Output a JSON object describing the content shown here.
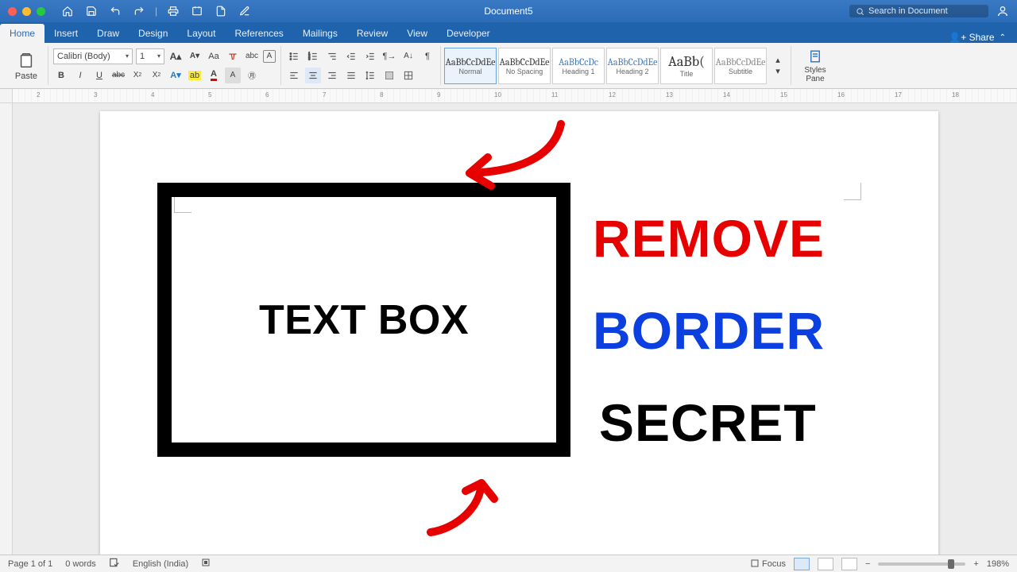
{
  "titlebar": {
    "document_name": "Document5",
    "search_placeholder": "Search in Document"
  },
  "tabs": {
    "items": [
      "Home",
      "Insert",
      "Draw",
      "Design",
      "Layout",
      "References",
      "Mailings",
      "Review",
      "View",
      "Developer"
    ],
    "active": "Home",
    "share": "Share"
  },
  "ribbon": {
    "paste": "Paste",
    "font_name": "Calibri (Body)",
    "font_size": "1",
    "bold": "B",
    "italic": "I",
    "underline": "U",
    "strike": "abc",
    "sub": "X",
    "sup": "X",
    "styles": [
      {
        "preview": "AaBbCcDdEe",
        "name": "Normal",
        "blue": false,
        "selected": true
      },
      {
        "preview": "AaBbCcDdEe",
        "name": "No Spacing",
        "blue": false,
        "selected": false
      },
      {
        "preview": "AaBbCcDc",
        "name": "Heading 1",
        "blue": true,
        "selected": false
      },
      {
        "preview": "AaBbCcDdEe",
        "name": "Heading 2",
        "blue": true,
        "selected": false
      },
      {
        "preview": "AaBb(",
        "name": "Title",
        "blue": false,
        "selected": false
      },
      {
        "preview": "AaBbCcDdEe",
        "name": "Subtitle",
        "blue": false,
        "selected": false
      }
    ],
    "styles_pane": "Styles\nPane"
  },
  "ruler": {
    "numbers": [
      "2",
      "3",
      "4",
      "5",
      "6",
      "7",
      "8",
      "9",
      "10",
      "11",
      "12",
      "13",
      "14",
      "15",
      "16",
      "17",
      "18"
    ]
  },
  "document": {
    "textbox_text": "TEXT BOX",
    "words": {
      "remove": "REMOVE",
      "border": "BORDER",
      "secret": "SECRET"
    }
  },
  "status": {
    "page": "Page 1 of 1",
    "words": "0 words",
    "language": "English (India)",
    "focus": "Focus",
    "zoom": "198%"
  }
}
